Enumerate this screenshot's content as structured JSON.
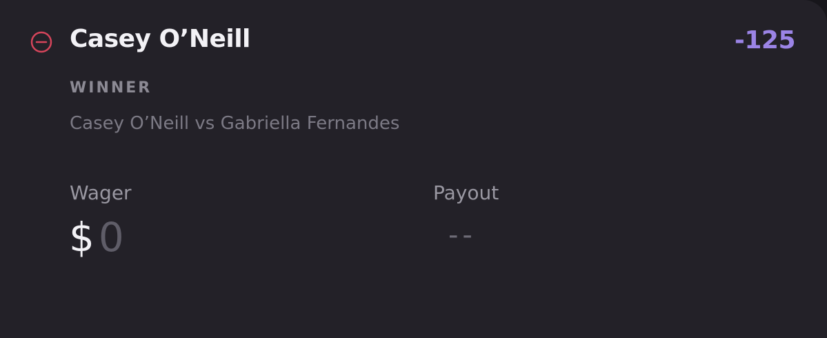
{
  "bet": {
    "remove_icon": "minus-circle-icon",
    "selection": "Casey O’Neill",
    "odds": "-125",
    "market_type": "WINNER",
    "matchup": "Casey O’Neill vs Gabriella Fernandes"
  },
  "wager": {
    "label": "Wager",
    "currency_symbol": "$",
    "amount_placeholder": "0"
  },
  "payout": {
    "label": "Payout",
    "value": "--"
  },
  "colors": {
    "card_background": "#232128",
    "odds_accent": "#9b84e6",
    "remove_icon": "#d6455b"
  }
}
